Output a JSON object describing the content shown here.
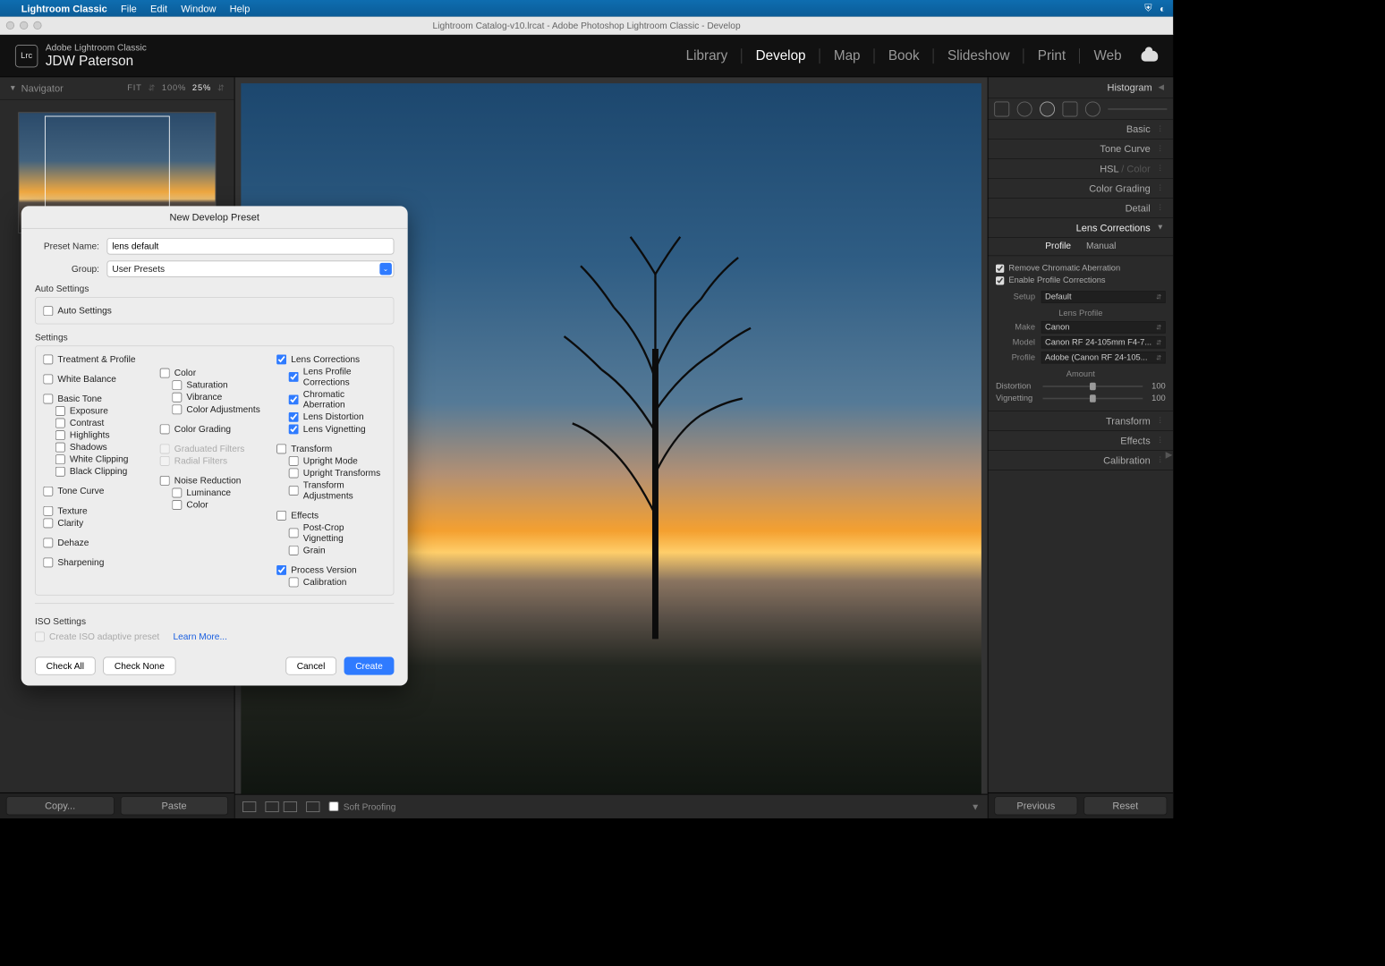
{
  "menubar": {
    "app": "Lightroom Classic",
    "items": [
      "File",
      "Edit",
      "Window",
      "Help"
    ]
  },
  "doc_title": "Lightroom Catalog-v10.lrcat - Adobe Photoshop Lightroom Classic - Develop",
  "header": {
    "product": "Adobe Lightroom Classic",
    "user": "JDW Paterson",
    "lrc": "Lrc"
  },
  "modules": [
    "Library",
    "Develop",
    "Map",
    "Book",
    "Slideshow",
    "Print",
    "Web"
  ],
  "active_module": "Develop",
  "navigator": {
    "title": "Navigator",
    "zooms": [
      "FIT",
      "100%",
      "25%"
    ],
    "active_zoom": "25%"
  },
  "left_footer": {
    "copy": "Copy...",
    "paste": "Paste"
  },
  "right_footer": {
    "prev": "Previous",
    "reset": "Reset"
  },
  "center_toolbar": {
    "soft_proof": "Soft Proofing"
  },
  "right": {
    "histogram": "Histogram",
    "sections": [
      "Basic",
      "Tone Curve",
      "HSL / Color",
      "Color Grading",
      "Detail",
      "Lens Corrections"
    ],
    "lens": {
      "tabs": [
        "Profile",
        "Manual"
      ],
      "chk1": "Remove Chromatic Aberration",
      "chk2": "Enable Profile Corrections",
      "setup_lbl": "Setup",
      "setup_val": "Default",
      "lens_profile": "Lens Profile",
      "make_lbl": "Make",
      "make_val": "Canon",
      "model_lbl": "Model",
      "model_val": "Canon RF 24-105mm F4-7...",
      "profile_lbl": "Profile",
      "profile_val": "Adobe (Canon RF 24-105...",
      "amount": "Amount",
      "dist_lbl": "Distortion",
      "dist_val": "100",
      "vig_lbl": "Vignetting",
      "vig_val": "100"
    },
    "after": [
      "Transform",
      "Effects",
      "Calibration"
    ]
  },
  "modal": {
    "title": "New Develop Preset",
    "preset_lbl": "Preset Name:",
    "preset_val": "lens default",
    "group_lbl": "Group:",
    "group_val": "User Presets",
    "auto_header": "Auto Settings",
    "auto_chk": "Auto Settings",
    "settings_header": "Settings",
    "col1": {
      "treatment": "Treatment & Profile",
      "wb": "White Balance",
      "basic": "Basic Tone",
      "basic_items": [
        "Exposure",
        "Contrast",
        "Highlights",
        "Shadows",
        "White Clipping",
        "Black Clipping"
      ],
      "tone": "Tone Curve",
      "texture": "Texture",
      "clarity": "Clarity",
      "dehaze": "Dehaze",
      "sharp": "Sharpening"
    },
    "col2": {
      "color": "Color",
      "color_items": [
        "Saturation",
        "Vibrance",
        "Color Adjustments"
      ],
      "grading": "Color Grading",
      "grad": "Graduated Filters",
      "rad": "Radial Filters",
      "nr": "Noise Reduction",
      "nr_items": [
        "Luminance",
        "Color"
      ]
    },
    "col3": {
      "lens": "Lens Corrections",
      "lens_items": [
        "Lens Profile Corrections",
        "Chromatic Aberration",
        "Lens Distortion",
        "Lens Vignetting"
      ],
      "transform": "Transform",
      "transform_items": [
        "Upright Mode",
        "Upright Transforms",
        "Transform Adjustments"
      ],
      "effects": "Effects",
      "effects_items": [
        "Post-Crop Vignetting",
        "Grain"
      ],
      "process": "Process Version",
      "calib": "Calibration"
    },
    "iso_header": "ISO Settings",
    "iso_chk": "Create ISO adaptive preset",
    "learn": "Learn More...",
    "check_all": "Check All",
    "check_none": "Check None",
    "cancel": "Cancel",
    "create": "Create"
  }
}
